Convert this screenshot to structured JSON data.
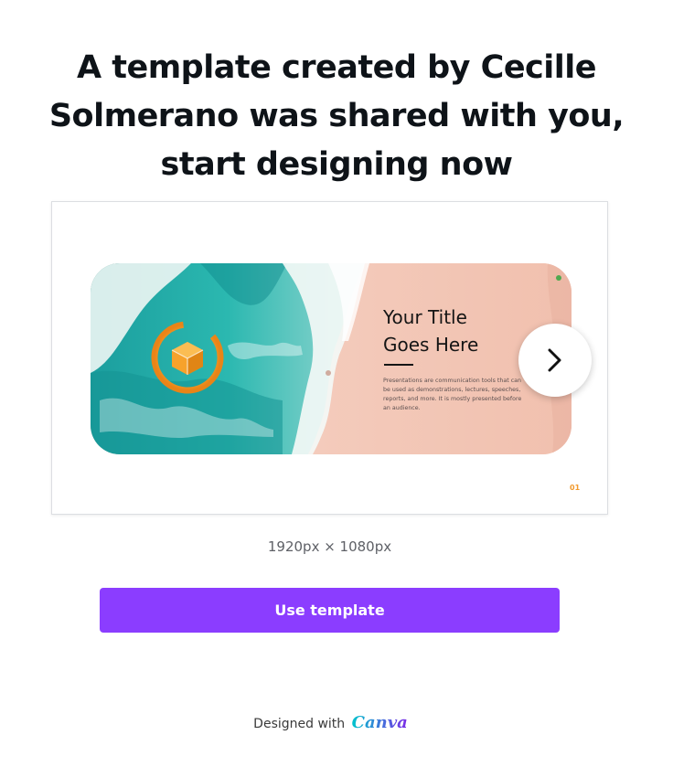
{
  "header": {
    "title": "A template created by Cecille Solmerano was shared with you, start designing now"
  },
  "preview": {
    "slide_title": "Your Title\nGoes Here",
    "slide_body": "Presentations are communication tools that can be used as demonstrations, lectures, speeches, reports, and more. It is mostly presented before an audience.",
    "page_number": "01",
    "next_icon": "chevron-right-icon",
    "logo_icon": "orange-cube-in-ring-icon"
  },
  "dimensions": "1920px × 1080px",
  "actions": {
    "use_template_label": "Use template"
  },
  "footer": {
    "designed_with": "Designed with",
    "brand": "Canva"
  },
  "colors": {
    "accent": "#8b3dff",
    "headline": "#0e1318",
    "slide_accent": "#f29a2e",
    "sea": "#1fa8a6",
    "sand": "#f4c7b8"
  }
}
